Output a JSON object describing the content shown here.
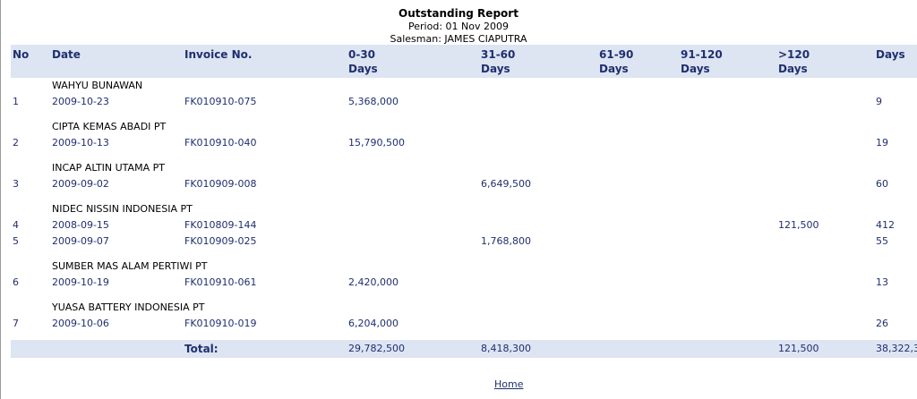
{
  "report": {
    "title": "Outstanding Report",
    "period": "Period: 01 Nov 2009",
    "salesman": "Salesman: JAMES CIAPUTRA"
  },
  "columns": {
    "no": "No",
    "date": "Date",
    "invoice": "Invoice No.",
    "d0_30_a": "0-30",
    "d0_30_b": "Days",
    "d31_60_a": "31-60",
    "d31_60_b": "Days",
    "d61_90_a": "61-90",
    "d61_90_b": "Days",
    "d91_120_a": "91-120",
    "d91_120_b": "Days",
    "d120_a": ">120",
    "d120_b": "Days",
    "days": "Days"
  },
  "groups": [
    {
      "customer": "WAHYU BUNAWAN",
      "rows": [
        {
          "no": "1",
          "date": "2009-10-23",
          "invoice": "FK010910-075",
          "d0_30": "5,368,000",
          "d31_60": "",
          "d61_90": "",
          "d91_120": "",
          "d120": "",
          "days": "9"
        }
      ]
    },
    {
      "customer": "CIPTA KEMAS ABADI PT",
      "rows": [
        {
          "no": "2",
          "date": "2009-10-13",
          "invoice": "FK010910-040",
          "d0_30": "15,790,500",
          "d31_60": "",
          "d61_90": "",
          "d91_120": "",
          "d120": "",
          "days": "19"
        }
      ]
    },
    {
      "customer": "INCAP ALTIN UTAMA PT",
      "rows": [
        {
          "no": "3",
          "date": "2009-09-02",
          "invoice": "FK010909-008",
          "d0_30": "",
          "d31_60": "6,649,500",
          "d61_90": "",
          "d91_120": "",
          "d120": "",
          "days": "60"
        }
      ]
    },
    {
      "customer": "NIDEC NISSIN INDONESIA PT",
      "rows": [
        {
          "no": "4",
          "date": "2008-09-15",
          "invoice": "FK010809-144",
          "d0_30": "",
          "d31_60": "",
          "d61_90": "",
          "d91_120": "",
          "d120": "121,500",
          "days": "412"
        },
        {
          "no": "5",
          "date": "2009-09-07",
          "invoice": "FK010909-025",
          "d0_30": "",
          "d31_60": "1,768,800",
          "d61_90": "",
          "d91_120": "",
          "d120": "",
          "days": "55"
        }
      ]
    },
    {
      "customer": "SUMBER MAS ALAM PERTIWI PT",
      "rows": [
        {
          "no": "6",
          "date": "2009-10-19",
          "invoice": "FK010910-061",
          "d0_30": "2,420,000",
          "d31_60": "",
          "d61_90": "",
          "d91_120": "",
          "d120": "",
          "days": "13"
        }
      ]
    },
    {
      "customer": "YUASA BATTERY INDONESIA PT",
      "rows": [
        {
          "no": "7",
          "date": "2009-10-06",
          "invoice": "FK010910-019",
          "d0_30": "6,204,000",
          "d31_60": "",
          "d61_90": "",
          "d91_120": "",
          "d120": "",
          "days": "26"
        }
      ]
    }
  ],
  "total": {
    "label": "Total:",
    "d0_30": "29,782,500",
    "d31_60": "8,418,300",
    "d120": "121,500",
    "grand": "38,322,3"
  },
  "footer": {
    "home_link": "Home"
  }
}
